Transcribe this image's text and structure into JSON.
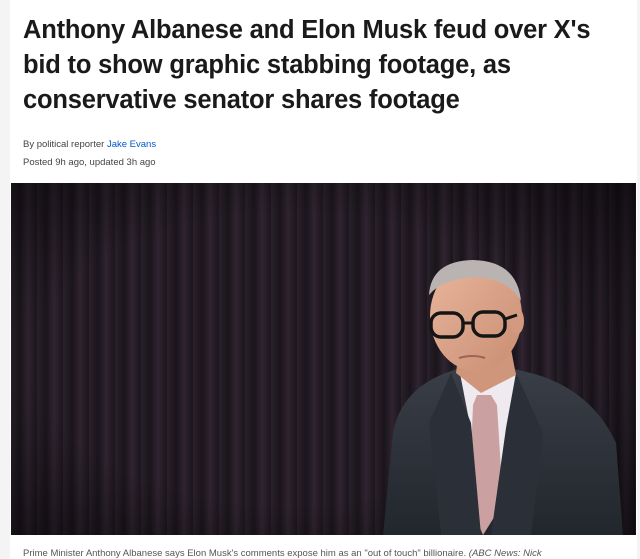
{
  "article": {
    "headline": "Anthony Albanese and Elon Musk feud over X's bid to show graphic stabbing footage, as conservative senator shares footage",
    "byline_prefix": "By political reporter",
    "author": "Jake Evans",
    "posted": "Posted 9h ago, updated 3h ago"
  },
  "hero": {
    "caption": "Prime Minister Anthony Albanese says Elon Musk's comments expose him as an \"out of touch\" billionaire.",
    "credit": "(ABC News: Nick"
  }
}
